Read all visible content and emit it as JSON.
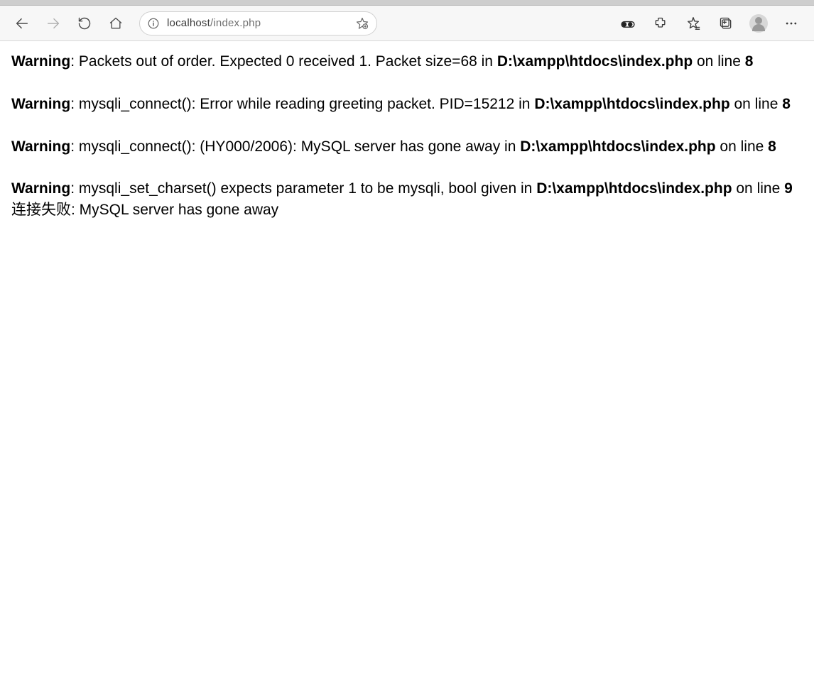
{
  "browser": {
    "url_host": "localhost",
    "url_path": "/index.php"
  },
  "warnings": [
    {
      "label": "Warning",
      "msg_before": ": Packets out of order. Expected 0 received 1. Packet size=68 in ",
      "file": "D:\\xampp\\htdocs\\index.php",
      "on_line": " on line ",
      "line": "8"
    },
    {
      "label": "Warning",
      "msg_before": ": mysqli_connect(): Error while reading greeting packet. PID=15212 in ",
      "file": "D:\\xampp\\htdocs\\index.php",
      "on_line": " on line ",
      "line": "8"
    },
    {
      "label": "Warning",
      "msg_before": ": mysqli_connect(): (HY000/2006): MySQL server has gone away in ",
      "file": "D:\\xampp\\htdocs\\index.php",
      "on_line": " on line ",
      "line": "8"
    },
    {
      "label": "Warning",
      "msg_before": ": mysqli_set_charset() expects parameter 1 to be mysqli, bool given in ",
      "file": "D:\\xampp\\htdocs\\index.php",
      "on_line": " on line ",
      "line": "9"
    }
  ],
  "trailing_message": "连接失败: MySQL server has gone away"
}
